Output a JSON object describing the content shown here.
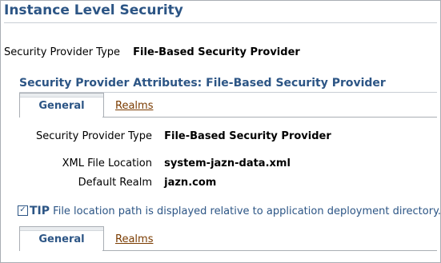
{
  "page": {
    "title": "Instance Level Security"
  },
  "top_fields": {
    "provider_type_label": "Security Provider Type",
    "provider_type_value": "File-Based Security Provider"
  },
  "attributes_section": {
    "title": "Security Provider Attributes: File-Based Security Provider",
    "tabs": [
      {
        "label": "General",
        "active": true
      },
      {
        "label": "Realms",
        "active": false
      }
    ],
    "fields": [
      {
        "label": "Security Provider Type",
        "value": "File-Based Security Provider"
      },
      {
        "label": "XML File Location",
        "value": "system-jazn-data.xml"
      },
      {
        "label": "Default Realm",
        "value": "jazn.com"
      }
    ],
    "tip": {
      "icon": "checkmark-icon",
      "label": "TIP",
      "text": "File location path is displayed relative to application deployment directory."
    },
    "bottom_tabs": [
      {
        "label": "General",
        "active": true
      },
      {
        "label": "Realms",
        "active": false
      }
    ]
  },
  "colors": {
    "heading": "#2c5585",
    "link": "#7a3b00",
    "border": "#a9aeb4"
  }
}
